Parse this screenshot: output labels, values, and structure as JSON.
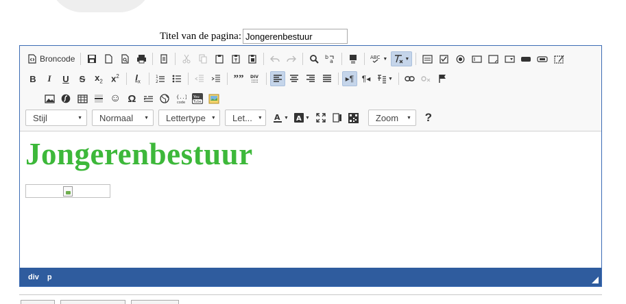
{
  "page": {
    "title_label": "Titel van de pagina:",
    "title_value": "Jongerenbestuur"
  },
  "toolbar": {
    "source_label": "Broncode",
    "styles_combo": "Stijl",
    "format_combo": "Normaal",
    "font_combo": "Lettertype",
    "size_combo": "Let...",
    "zoom_combo": "Zoom",
    "help": "?",
    "bold": "B",
    "italic": "I",
    "underline": "U",
    "strike": "S",
    "subscript_base": "x",
    "subscript_mark": "2",
    "superscript_base": "x",
    "superscript_mark": "2",
    "remove_format_base": "I",
    "remove_format_mark": "x",
    "blockquote": "””",
    "paragraph_mark": "¶",
    "omega": "Ω",
    "smiley": "☺"
  },
  "content": {
    "heading": "Jongerenbestuur"
  },
  "status": {
    "path": [
      "div",
      "p"
    ]
  },
  "colors": {
    "accent_blue": "#2f5c9e",
    "heading_green": "#3db83a",
    "active_button_bg": "#c5d5ea",
    "logo_orange": "#f57c13"
  }
}
